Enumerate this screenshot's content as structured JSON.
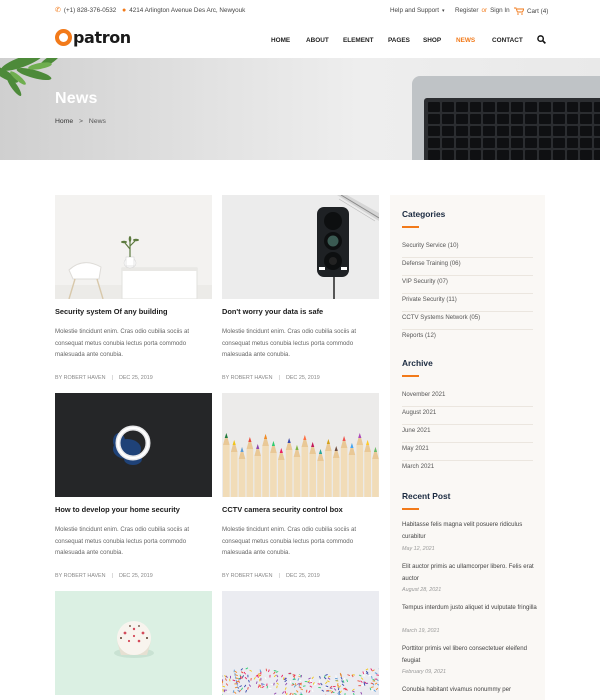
{
  "topbar": {
    "phone": "(+1) 828-376-0532",
    "address": "4214 Arlington Avenue Des Arc, Newyouk",
    "help": "Help and Support",
    "register": "Register",
    "or": "or",
    "signin": "Sign In",
    "cart": "Cart (4)"
  },
  "brand": {
    "name": "patron",
    "accent_color": "#f27a1a"
  },
  "nav": {
    "items": [
      "HOME",
      "ABOUT",
      "ELEMENT",
      "PAGES",
      "SHOP",
      "NEWS",
      "CONTACT"
    ],
    "active": "NEWS"
  },
  "hero": {
    "title": "News",
    "breadcrumb": {
      "home": "Home",
      "sep": ">",
      "current": "News"
    }
  },
  "posts": [
    {
      "title": "Security system Of any building",
      "excerpt": "Molestie tincidunt enim. Cras odio cubilia sociis at consequat metus conubia lectus porta commodo malesuada ante conubia.",
      "author": "BY ROBERT HAVEN",
      "date": "DEC 25, 2019",
      "image": "white-chair-plant"
    },
    {
      "title": "Don't worry your data is safe",
      "excerpt": "Molestie tincidunt enim. Cras odio cubilia sociis at consequat metus conubia lectus porta commodo malesuada ante conubia.",
      "author": "BY ROBERT HAVEN",
      "date": "DEC 25, 2019",
      "image": "traffic-light"
    },
    {
      "title": "How to develop your home security",
      "excerpt": "Molestie tincidunt enim. Cras odio cubilia sociis at consequat metus conubia lectus porta commodo malesuada ante conubia.",
      "author": "BY ROBERT HAVEN",
      "date": "DEC 25, 2019",
      "image": "smoke-ring"
    },
    {
      "title": "CCTV camera security control box",
      "excerpt": "Molestie tincidunt enim. Cras odio cubilia sociis at consequat metus conubia lectus porta commodo malesuada ante conubia.",
      "author": "BY ROBERT HAVEN",
      "date": "DEC 25, 2019",
      "image": "colored-pencils"
    },
    {
      "image": "cupcake"
    },
    {
      "image": "sprinkles"
    }
  ],
  "sidebar": {
    "categories_title": "Categories",
    "categories": [
      "Security Service (10)",
      "Defense Training (06)",
      "VIP Security (07)",
      "Private Security (11)",
      "CCTV Systems Network (05)",
      "Reports (12)"
    ],
    "archive_title": "Archive",
    "archive": [
      "November 2021",
      "August 2021",
      "June 2021",
      "May 2021",
      "March 2021"
    ],
    "recent_title": "Recent Post",
    "recent": [
      {
        "title": "Habitasse felis magna velit posuere ridiculus curabitur",
        "date": "May 12, 2021"
      },
      {
        "title": "Elit auctor primis ac ullamcorper libero. Felis erat auctor",
        "date": "August 28, 2021"
      },
      {
        "title": "Tempus interdum justo aliquet id vulputate fringilla",
        "date": "March 19, 2021"
      },
      {
        "title": "Porttitor primis vel libero consectetuer eleifend feugiat",
        "date": "February 09, 2021"
      },
      {
        "title": "Conubia habitant vivamus nonummy per",
        "date": ""
      }
    ]
  }
}
